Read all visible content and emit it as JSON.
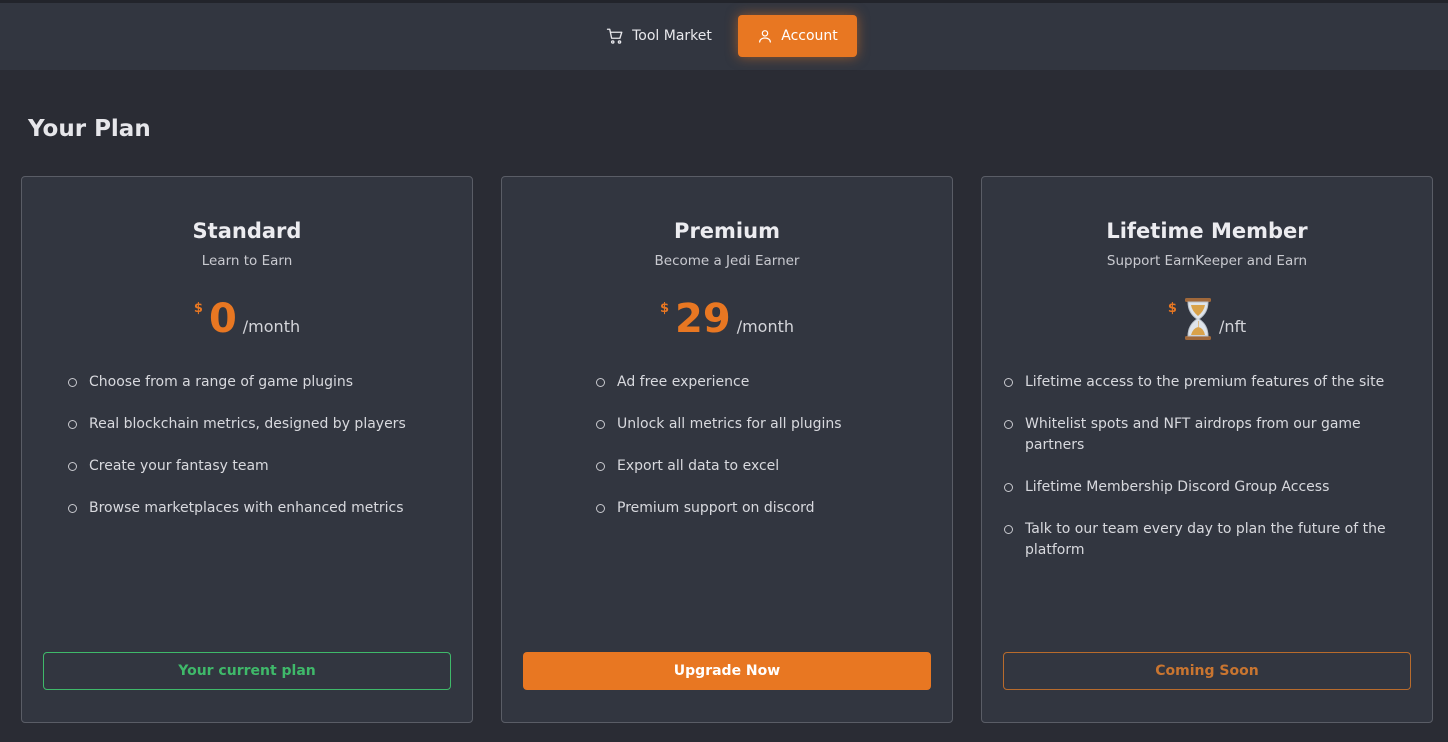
{
  "nav": {
    "tool_market": "Tool Market",
    "account": "Account"
  },
  "page": {
    "title": "Your Plan"
  },
  "plans": [
    {
      "title": "Standard",
      "subtitle": "Learn to Earn",
      "currency": "$",
      "amount": "0",
      "period": "/month",
      "features": [
        "Choose from a range of game plugins",
        "Real blockchain metrics, designed by players",
        "Create your fantasy team",
        "Browse marketplaces with enhanced metrics"
      ],
      "button": "Your current plan"
    },
    {
      "title": "Premium",
      "subtitle": "Become a Jedi Earner",
      "currency": "$",
      "amount": "29",
      "period": "/month",
      "features": [
        "Ad free experience",
        "Unlock all metrics for all plugins",
        "Export all data to excel",
        "Premium support on discord"
      ],
      "button": "Upgrade Now"
    },
    {
      "title": "Lifetime Member",
      "subtitle": "Support EarnKeeper and Earn",
      "currency": "$",
      "amount_icon": "hourglass-icon",
      "period": "/nft",
      "features": [
        "Lifetime access to the premium features of the site",
        "Whitelist spots and NFT airdrops from our game partners",
        "Lifetime Membership Discord Group Access",
        "Talk to our team every day to plan the future of the platform"
      ],
      "button": "Coming Soon"
    }
  ],
  "colors": {
    "accent": "#e87722",
    "success": "#3fb96a",
    "background": "#2a2c34",
    "panel": "#323640"
  }
}
